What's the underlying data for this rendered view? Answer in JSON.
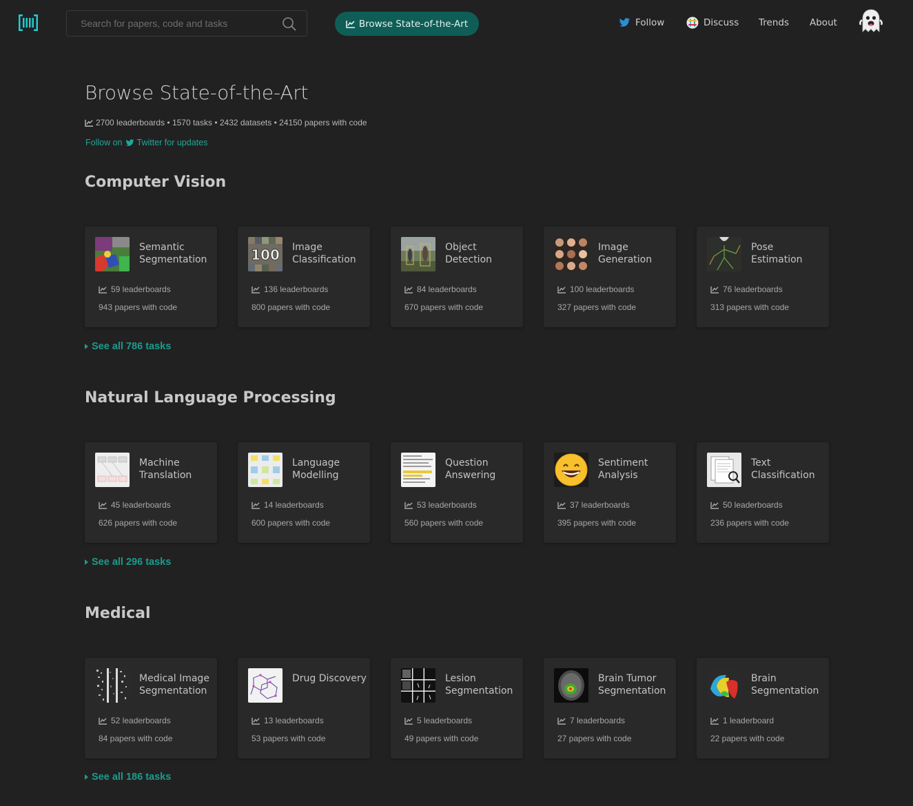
{
  "nav": {
    "search_placeholder": "Search for papers, code and tasks",
    "browse_label": "Browse State-of-the-Art",
    "follow_label": "Follow",
    "discuss_label": "Discuss",
    "trends_label": "Trends",
    "about_label": "About",
    "colors": {
      "accent": "#0e5e57",
      "link": "#1c9b8d",
      "twitter": "#1da1f2"
    }
  },
  "header": {
    "title": "Browse State-of-the-Art",
    "stats": "2700 leaderboards • 1570 tasks • 2432 datasets • 24150 papers with code",
    "follow_prefix": "Follow on",
    "follow_link": "Twitter for updates"
  },
  "sections": [
    {
      "title": "Computer Vision",
      "see_all": "See all 786 tasks",
      "cards": [
        {
          "name": "Semantic Segmentation",
          "leaderboards": "59 leaderboards",
          "papers": "943 papers with code",
          "thumb": "segmentation-thumb"
        },
        {
          "name": "Image Classification",
          "leaderboards": "136 leaderboards",
          "papers": "800 papers with code",
          "thumb": "cifar-thumb",
          "thumb_text": "100"
        },
        {
          "name": "Object Detection",
          "leaderboards": "84 leaderboards",
          "papers": "670 papers with code",
          "thumb": "detection-thumb"
        },
        {
          "name": "Image Generation",
          "leaderboards": "100 leaderboards",
          "papers": "327 papers with code",
          "thumb": "faces-thumb"
        },
        {
          "name": "Pose Estimation",
          "leaderboards": "76 leaderboards",
          "papers": "313 papers with code",
          "thumb": "pose-thumb"
        }
      ]
    },
    {
      "title": "Natural Language Processing",
      "see_all": "See all 296 tasks",
      "cards": [
        {
          "name": "Machine Translation",
          "leaderboards": "45 leaderboards",
          "papers": "626 papers with code",
          "thumb": "translation-thumb"
        },
        {
          "name": "Language Modelling",
          "leaderboards": "14 leaderboards",
          "papers": "600 papers with code",
          "thumb": "lm-thumb"
        },
        {
          "name": "Question Answering",
          "leaderboards": "53 leaderboards",
          "papers": "560 papers with code",
          "thumb": "qa-thumb"
        },
        {
          "name": "Sentiment Analysis",
          "leaderboards": "37 leaderboards",
          "papers": "395 papers with code",
          "thumb": "smiley-thumb"
        },
        {
          "name": "Text Classification",
          "leaderboards": "50 leaderboards",
          "papers": "236 papers with code",
          "thumb": "documents-thumb"
        }
      ]
    },
    {
      "title": "Medical",
      "see_all": "See all 186 tasks",
      "cards": [
        {
          "name": "Medical Image Segmentation",
          "leaderboards": "52 leaderboards",
          "papers": "84 papers with code",
          "thumb": "cells-thumb"
        },
        {
          "name": "Drug Discovery",
          "leaderboards": "13 leaderboards",
          "papers": "53 papers with code",
          "thumb": "molecule-thumb"
        },
        {
          "name": "Lesion Segmentation",
          "leaderboards": "5 leaderboards",
          "papers": "49 papers with code",
          "thumb": "lesion-thumb"
        },
        {
          "name": "Brain Tumor Segmentation",
          "leaderboards": "7 leaderboards",
          "papers": "27 papers with code",
          "thumb": "brain-mri-thumb"
        },
        {
          "name": "Brain Segmentation",
          "leaderboards": "1 leaderboard",
          "papers": "22 papers with code",
          "thumb": "brain-3d-thumb"
        }
      ]
    }
  ]
}
